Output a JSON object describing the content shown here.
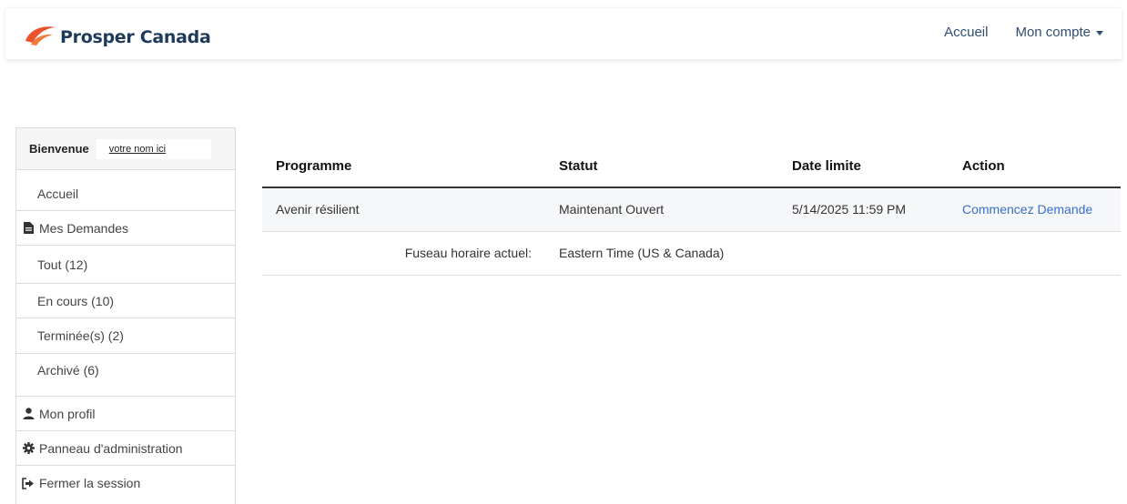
{
  "brand": {
    "name": "Prosper Canada",
    "accent": "#e8532a",
    "text_color": "#1f3b5c"
  },
  "nav": {
    "home": "Accueil",
    "account": "Mon compte"
  },
  "sidebar": {
    "welcome_label": "Bienvenue",
    "user_name": "votre nom ici",
    "items": [
      {
        "label": "Accueil"
      },
      {
        "label": "Mes Demandes",
        "icon": "document-icon"
      },
      {
        "label": "Tout (12)"
      },
      {
        "label": "En cours (10)"
      },
      {
        "label": "Terminée(s) (2)"
      },
      {
        "label": "Archivé (6)"
      },
      {
        "label": "Mon profil",
        "icon": "user-icon"
      },
      {
        "label": "Panneau d'administration",
        "icon": "gear-icon"
      },
      {
        "label": "Fermer la session",
        "icon": "sign-out-icon"
      }
    ]
  },
  "table": {
    "headers": [
      "Programme",
      "Statut",
      "Date limite",
      "Action"
    ],
    "rows": [
      {
        "programme": "Avenir résilient",
        "statut": "Maintenant Ouvert",
        "date": "5/14/2025 11:59 PM",
        "action": "Commencez Demande"
      }
    ],
    "timezone_label": "Fuseau horaire actuel:",
    "timezone_value": "Eastern Time (US & Canada)"
  },
  "colors": {
    "link": "#3a6fc9",
    "row_shade": "#f5f7f9",
    "border": "#dddddd"
  }
}
